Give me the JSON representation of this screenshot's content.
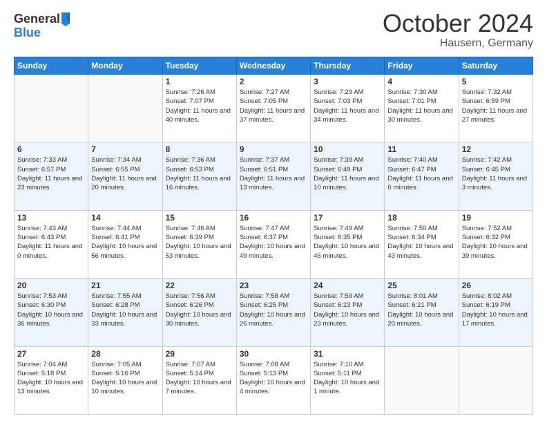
{
  "header": {
    "logo_general": "General",
    "logo_blue": "Blue",
    "month": "October 2024",
    "location": "Hausern, Germany"
  },
  "weekdays": [
    "Sunday",
    "Monday",
    "Tuesday",
    "Wednesday",
    "Thursday",
    "Friday",
    "Saturday"
  ],
  "weeks": [
    [
      {
        "day": "",
        "info": ""
      },
      {
        "day": "",
        "info": ""
      },
      {
        "day": "1",
        "info": "Sunrise: 7:26 AM\nSunset: 7:07 PM\nDaylight: 11 hours and 40 minutes."
      },
      {
        "day": "2",
        "info": "Sunrise: 7:27 AM\nSunset: 7:05 PM\nDaylight: 11 hours and 37 minutes."
      },
      {
        "day": "3",
        "info": "Sunrise: 7:29 AM\nSunset: 7:03 PM\nDaylight: 11 hours and 34 minutes."
      },
      {
        "day": "4",
        "info": "Sunrise: 7:30 AM\nSunset: 7:01 PM\nDaylight: 11 hours and 30 minutes."
      },
      {
        "day": "5",
        "info": "Sunrise: 7:32 AM\nSunset: 6:59 PM\nDaylight: 11 hours and 27 minutes."
      }
    ],
    [
      {
        "day": "6",
        "info": "Sunrise: 7:33 AM\nSunset: 6:57 PM\nDaylight: 11 hours and 23 minutes."
      },
      {
        "day": "7",
        "info": "Sunrise: 7:34 AM\nSunset: 6:55 PM\nDaylight: 11 hours and 20 minutes."
      },
      {
        "day": "8",
        "info": "Sunrise: 7:36 AM\nSunset: 6:53 PM\nDaylight: 11 hours and 16 minutes."
      },
      {
        "day": "9",
        "info": "Sunrise: 7:37 AM\nSunset: 6:51 PM\nDaylight: 11 hours and 13 minutes."
      },
      {
        "day": "10",
        "info": "Sunrise: 7:39 AM\nSunset: 6:49 PM\nDaylight: 11 hours and 10 minutes."
      },
      {
        "day": "11",
        "info": "Sunrise: 7:40 AM\nSunset: 6:47 PM\nDaylight: 11 hours and 6 minutes."
      },
      {
        "day": "12",
        "info": "Sunrise: 7:42 AM\nSunset: 6:45 PM\nDaylight: 11 hours and 3 minutes."
      }
    ],
    [
      {
        "day": "13",
        "info": "Sunrise: 7:43 AM\nSunset: 6:43 PM\nDaylight: 11 hours and 0 minutes."
      },
      {
        "day": "14",
        "info": "Sunrise: 7:44 AM\nSunset: 6:41 PM\nDaylight: 10 hours and 56 minutes."
      },
      {
        "day": "15",
        "info": "Sunrise: 7:46 AM\nSunset: 6:39 PM\nDaylight: 10 hours and 53 minutes."
      },
      {
        "day": "16",
        "info": "Sunrise: 7:47 AM\nSunset: 6:37 PM\nDaylight: 10 hours and 49 minutes."
      },
      {
        "day": "17",
        "info": "Sunrise: 7:49 AM\nSunset: 6:35 PM\nDaylight: 10 hours and 46 minutes."
      },
      {
        "day": "18",
        "info": "Sunrise: 7:50 AM\nSunset: 6:34 PM\nDaylight: 10 hours and 43 minutes."
      },
      {
        "day": "19",
        "info": "Sunrise: 7:52 AM\nSunset: 6:32 PM\nDaylight: 10 hours and 39 minutes."
      }
    ],
    [
      {
        "day": "20",
        "info": "Sunrise: 7:53 AM\nSunset: 6:30 PM\nDaylight: 10 hours and 36 minutes."
      },
      {
        "day": "21",
        "info": "Sunrise: 7:55 AM\nSunset: 6:28 PM\nDaylight: 10 hours and 33 minutes."
      },
      {
        "day": "22",
        "info": "Sunrise: 7:56 AM\nSunset: 6:26 PM\nDaylight: 10 hours and 30 minutes."
      },
      {
        "day": "23",
        "info": "Sunrise: 7:58 AM\nSunset: 6:25 PM\nDaylight: 10 hours and 26 minutes."
      },
      {
        "day": "24",
        "info": "Sunrise: 7:59 AM\nSunset: 6:23 PM\nDaylight: 10 hours and 23 minutes."
      },
      {
        "day": "25",
        "info": "Sunrise: 8:01 AM\nSunset: 6:21 PM\nDaylight: 10 hours and 20 minutes."
      },
      {
        "day": "26",
        "info": "Sunrise: 8:02 AM\nSunset: 6:19 PM\nDaylight: 10 hours and 17 minutes."
      }
    ],
    [
      {
        "day": "27",
        "info": "Sunrise: 7:04 AM\nSunset: 5:18 PM\nDaylight: 10 hours and 13 minutes."
      },
      {
        "day": "28",
        "info": "Sunrise: 7:05 AM\nSunset: 5:16 PM\nDaylight: 10 hours and 10 minutes."
      },
      {
        "day": "29",
        "info": "Sunrise: 7:07 AM\nSunset: 5:14 PM\nDaylight: 10 hours and 7 minutes."
      },
      {
        "day": "30",
        "info": "Sunrise: 7:08 AM\nSunset: 5:13 PM\nDaylight: 10 hours and 4 minutes."
      },
      {
        "day": "31",
        "info": "Sunrise: 7:10 AM\nSunset: 5:11 PM\nDaylight: 10 hours and 1 minute."
      },
      {
        "day": "",
        "info": ""
      },
      {
        "day": "",
        "info": ""
      }
    ]
  ]
}
